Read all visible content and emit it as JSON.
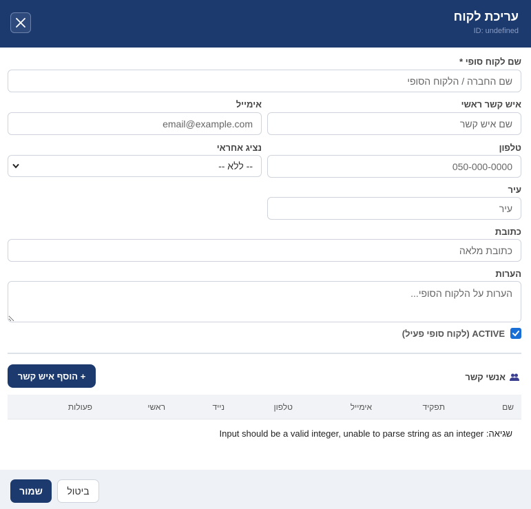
{
  "header": {
    "title": "עריכת לקוח",
    "subtitle": "ID: undefined"
  },
  "form": {
    "end_customer_name": {
      "label": "שם לקוח סופי *",
      "placeholder": "שם החברה / הלקוח הסופי",
      "value": ""
    },
    "main_contact": {
      "label": "איש קשר ראשי",
      "placeholder": "שם איש קשר",
      "value": ""
    },
    "email": {
      "label": "אימייל",
      "placeholder": "email@example.com",
      "value": ""
    },
    "phone": {
      "label": "טלפון",
      "placeholder": "050-000-0000",
      "value": ""
    },
    "rep": {
      "label": "נציג אחראי",
      "selected": "-- ללא --"
    },
    "city": {
      "label": "עיר",
      "placeholder": "עיר",
      "value": ""
    },
    "address": {
      "label": "כתובת",
      "placeholder": "כתובת מלאה",
      "value": ""
    },
    "notes": {
      "label": "הערות",
      "placeholder": "הערות על הלקוח הסופי...",
      "value": ""
    },
    "active": {
      "label": "ACTIVE (לקוח סופי פעיל)",
      "checked": true
    }
  },
  "contacts": {
    "title": "אנשי קשר",
    "add_button": "+ הוסף איש קשר",
    "columns": [
      "שם",
      "תפקיד",
      "אימייל",
      "טלפון",
      "נייד",
      "ראשי",
      "פעולות"
    ],
    "error": "שגיאה: Input should be a valid integer, unable to parse string as an integer"
  },
  "footer": {
    "save_label": "שמור",
    "cancel_label": "ביטול"
  },
  "colors": {
    "primary": "#1c3a6e",
    "checkbox": "#1a6fd6"
  }
}
